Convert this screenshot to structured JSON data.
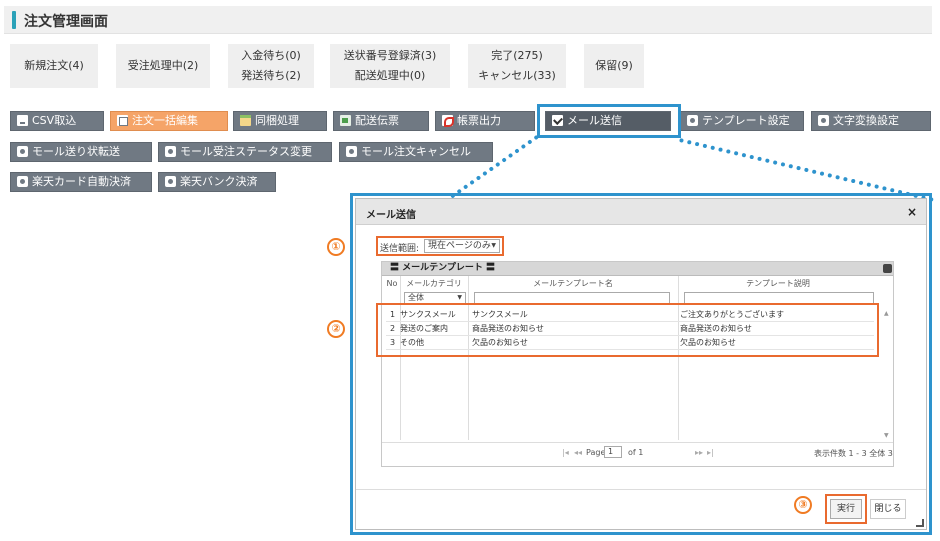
{
  "header": {
    "title": "注文管理画面"
  },
  "status_tabs": [
    {
      "line1": "新規注文(4)",
      "line2": ""
    },
    {
      "line1": "受注処理中(2)",
      "line2": ""
    },
    {
      "line1": "入金待ち(0)",
      "line2": "発送待ち(2)"
    },
    {
      "line1": "送状番号登録済(3)",
      "line2": "配送処理中(0)"
    },
    {
      "line1": "完了(275)",
      "line2": "キャンセル(33)"
    },
    {
      "line1": "保留(9)",
      "line2": ""
    }
  ],
  "toolbar": {
    "csv_import": "CSV取込",
    "bulk_edit": "注文一括編集",
    "bundle": "同梱処理",
    "slip": "配送伝票",
    "form_output": "帳票出力",
    "send_mail": "メール送信",
    "template_settings": "テンプレート設定",
    "char_convert": "文字変換設定",
    "mall_transfer": "モール送り状転送",
    "mall_status_change": "モール受注ステータス変更",
    "mall_cancel": "モール注文キャンセル",
    "rakuten_card": "楽天カード自動決済",
    "rakuten_bank": "楽天バンク決済"
  },
  "dialog": {
    "title": "メール送信",
    "close_glyph": "×",
    "scope_label": "送信範囲:",
    "scope_value": "現在ページのみ",
    "grid_title": "メールテンプレート",
    "columns": {
      "no": "No",
      "category": "メールカテゴリ",
      "name": "メールテンプレート名",
      "desc": "テンプレート説明"
    },
    "filter_category": "全体",
    "rows": [
      {
        "no": "1",
        "category": "サンクスメール",
        "name": "サンクスメール",
        "desc": "ご注文ありがとうございます"
      },
      {
        "no": "2",
        "category": "発送のご案内",
        "name": "商品発送のお知らせ",
        "desc": "商品発送のお知らせ"
      },
      {
        "no": "3",
        "category": "その他",
        "name": "欠品のお知らせ",
        "desc": "欠品のお知らせ"
      }
    ],
    "pager": {
      "page_label": "Page",
      "page_value": "1",
      "of_label": "of 1",
      "count_text": "表示件数 1 - 3 全体 3"
    },
    "execute": "実行",
    "close": "閉じる"
  },
  "callouts": [
    "①",
    "②",
    "③"
  ],
  "icons": {
    "scroll_up": "▲",
    "scroll_down": "▼",
    "dropdown": "▼",
    "first": "|◂",
    "prev": "◂◂",
    "next": "▸▸",
    "last": "▸|"
  }
}
